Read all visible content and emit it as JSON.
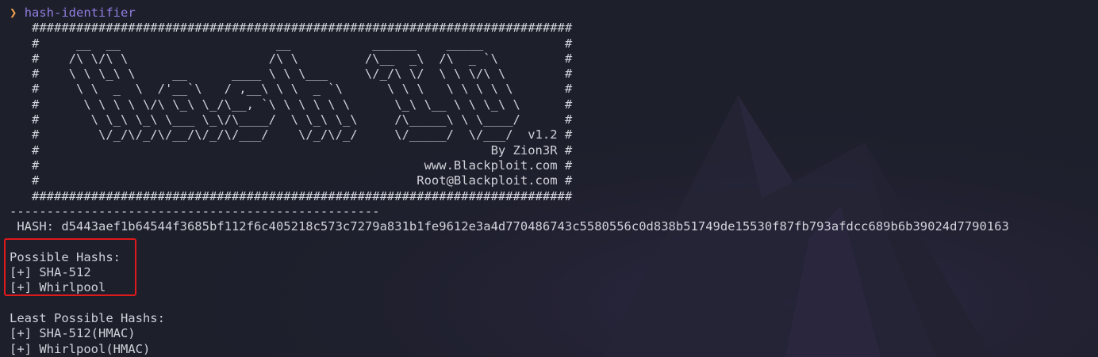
{
  "prompt": {
    "arrow": "❯",
    "command": "hash-identifier"
  },
  "banner_lines": [
    "   #########################################################################",
    "   #     __  __                     __           ______    _____           #",
    "   #    /\\ \\/\\ \\                   /\\ \\         /\\__  _\\  /\\  _ `\\         #",
    "   #    \\ \\ \\_\\ \\     __      ____ \\ \\ \\___     \\/_/\\ \\/  \\ \\ \\/\\ \\        #",
    "   #     \\ \\  _  \\  /'__`\\   / ,__\\ \\ \\  _ `\\      \\ \\ \\   \\ \\ \\ \\ \\       #",
    "   #      \\ \\ \\ \\ \\/\\ \\_\\ \\_/\\__, `\\ \\ \\ \\ \\ \\      \\_\\ \\__ \\ \\ \\_\\ \\      #",
    "   #       \\ \\_\\ \\_\\ \\___ \\_\\/\\____/  \\ \\_\\ \\_\\     /\\_____\\ \\ \\____/      #",
    "   #        \\/_/\\/_/\\/__/\\/_/\\/___/    \\/_/\\/_/     \\/_____/  \\/___/  v1.2 #",
    "   #                                                             By Zion3R #",
    "   #                                                    www.Blackploit.com #",
    "   #                                                   Root@Blackploit.com #",
    "   #########################################################################"
  ],
  "separator": "--------------------------------------------------",
  "hash_line": " HASH: d5443aef1b64544f3685bf112f6c405218c573c7279a831b1fe9612e3a4d770486743c5580556c0d838b51749de15530f87fb793afdcc689b6b39024d7790163",
  "possible": {
    "heading": "Possible Hashs:",
    "items": [
      "[+] SHA-512",
      "[+] Whirlpool"
    ]
  },
  "least_possible": {
    "heading": "Least Possible Hashs:",
    "items": [
      "[+] SHA-512(HMAC)",
      "[+] Whirlpool(HMAC)"
    ]
  },
  "colors": {
    "background": "#1d1f2b",
    "text": "#d0d2da",
    "prompt_arrow": "#f0a04b",
    "prompt_command": "#8d7fe0",
    "highlight_border": "#e0191b"
  }
}
